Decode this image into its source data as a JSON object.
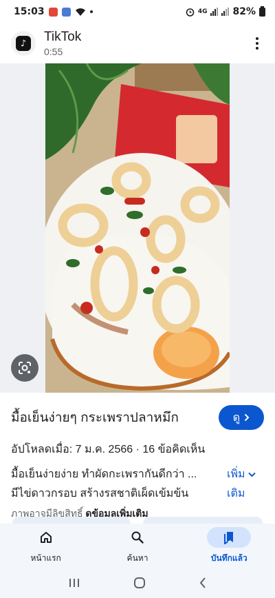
{
  "status_bar": {
    "time": "15:03",
    "network_label": "4G",
    "battery": "82%"
  },
  "app_header": {
    "title": "TikTok",
    "duration": "0:55"
  },
  "video": {
    "title": "มื้อเย็นง่ายๆ กระเพราปลาหมึก",
    "view_button_label": "ดู",
    "meta": "อัปโหลดเมื่อ: 7 ม.ค. 2566 · 16 ข้อคิดเห็น",
    "description_lines": [
      "มื้อเย็นง่ายง่าย ทำผัดกะเพรากันดีกว่า ...",
      "มีไข่ดาวกรอบ สร้างรสชาติเผ็ดเข้มข้น"
    ],
    "more_label_line1": "เพิ่ม",
    "more_label_line2": "เติม",
    "copyright_text": "ภาพอาจมีลิขสิทธิ์",
    "more_info_link": "ดูข้อมูลเพิ่มเติม"
  },
  "bottom_nav": {
    "items": [
      {
        "label": "หน้าแรก",
        "icon": "home-icon",
        "active": false
      },
      {
        "label": "ค้นหา",
        "icon": "search-icon",
        "active": false
      },
      {
        "label": "บันทึกแล้ว",
        "icon": "bookmark-icon",
        "active": true
      }
    ]
  },
  "colors": {
    "accent": "#0b57d0",
    "nav_active_pill": "#d3e3fd",
    "nav_bg": "#f3f6fb"
  }
}
